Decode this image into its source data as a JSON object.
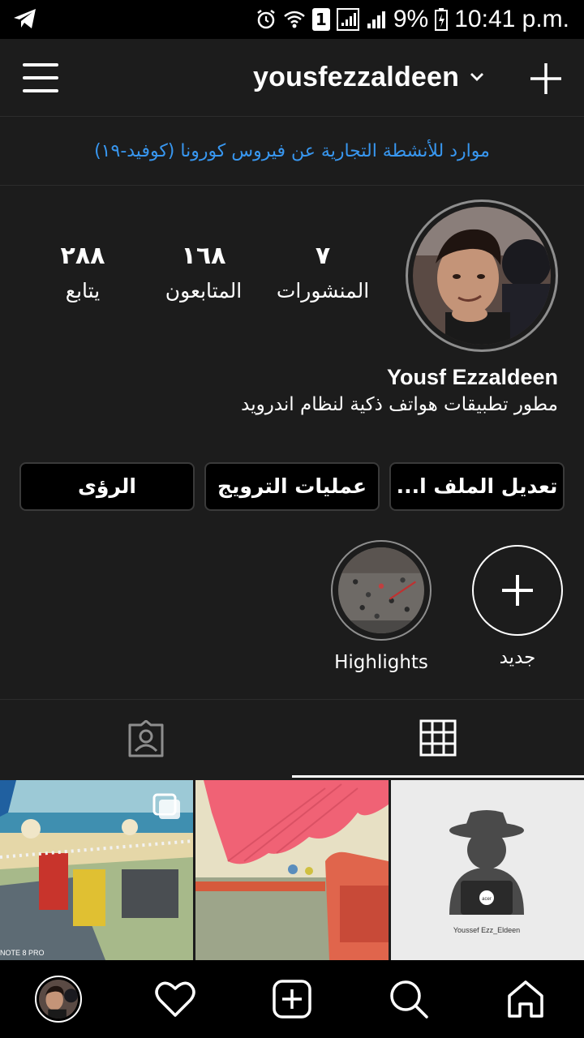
{
  "status_bar": {
    "battery_percent": "9%",
    "time": "10:41 p.m.",
    "sim_slot": "1",
    "icons": [
      "telegram-icon",
      "alarm-icon",
      "wifi-icon",
      "sim-signal-icon",
      "signal-icon",
      "battery-icon"
    ]
  },
  "header": {
    "username": "yousfezzaldeen",
    "icons": [
      "menu-icon",
      "chevron-down-icon",
      "plus-icon"
    ]
  },
  "banner": {
    "text": "موارد للأنشطة التجارية عن فيروس كورونا (كوفيد-١٩)",
    "color": "#3897f0"
  },
  "profile": {
    "stats": [
      {
        "number": "٧",
        "label": "المنشورات"
      },
      {
        "number": "١٦٨",
        "label": "المتابعون"
      },
      {
        "number": "٢٨٨",
        "label": "يتابع"
      }
    ],
    "full_name": "Yousf Ezzaldeen",
    "bio": "مطور تطبيقات هواتف ذكية لنظام اندرويد"
  },
  "actions": {
    "edit_profile": "تعديل الملف ا...",
    "promotions": "عمليات الترويج",
    "insights": "الرؤى"
  },
  "highlights": [
    {
      "label": "جديد"
    },
    {
      "label": "Highlights"
    }
  ],
  "tabs": [
    "grid-icon",
    "tagged-icon"
  ],
  "posts": [
    {
      "caption": ""
    },
    {
      "caption": ""
    },
    {
      "caption": "Youssef Ezz_Eldeen",
      "logo_text": "acer"
    }
  ],
  "photo_watermark": "NOTE 8 PRO",
  "bottom_nav": [
    "home-icon",
    "search-icon",
    "add-post-icon",
    "heart-icon",
    "profile-avatar"
  ],
  "colors": {
    "background": "#1c1c1c",
    "link": "#3897f0",
    "border": "#3a3a3a"
  }
}
